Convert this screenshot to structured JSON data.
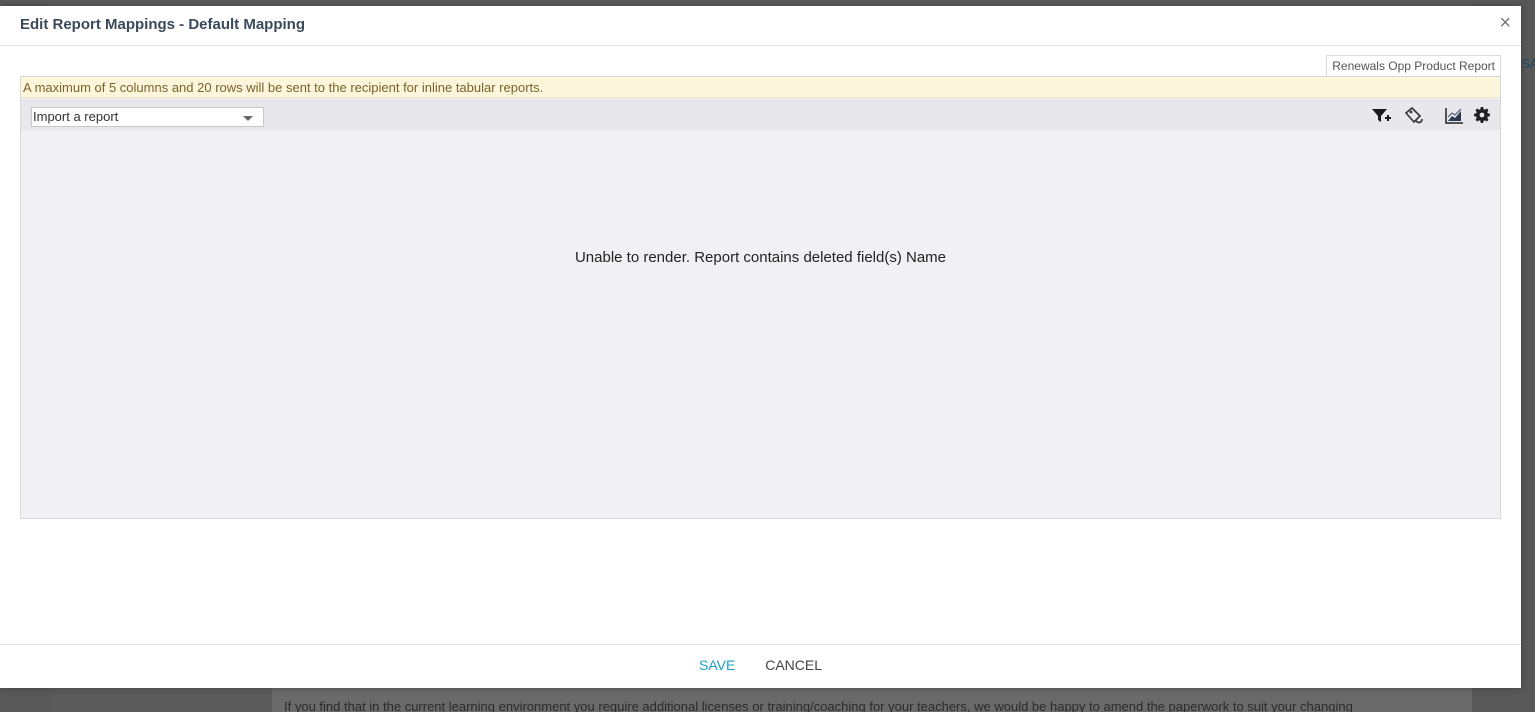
{
  "background": {
    "edge_text": "SA",
    "body_text": "If you find that in the current learning environment you require additional licenses or training/coaching for your teachers, we would be happy to amend the paperwork to suit your changing"
  },
  "modal": {
    "title": "Edit Report Mappings - Default Mapping",
    "close_label": "×",
    "report_name": "Renewals Opp Product Report",
    "notice": "A maximum of 5 columns and 20 rows will be sent to the recipient for inline tabular reports.",
    "import_select": {
      "value": "Import a report"
    },
    "toolbar_icons": [
      "filter-add-icon",
      "tag-icon",
      "chart-icon",
      "gear-icon"
    ],
    "message": "Unable to render. Report contains deleted field(s) Name",
    "footer": {
      "save_label": "SAVE",
      "cancel_label": "CANCEL"
    }
  },
  "colors": {
    "accent": "#1aa3c7",
    "notice_bg": "#fdf5dc",
    "panel_bg": "#f1f0f4"
  }
}
